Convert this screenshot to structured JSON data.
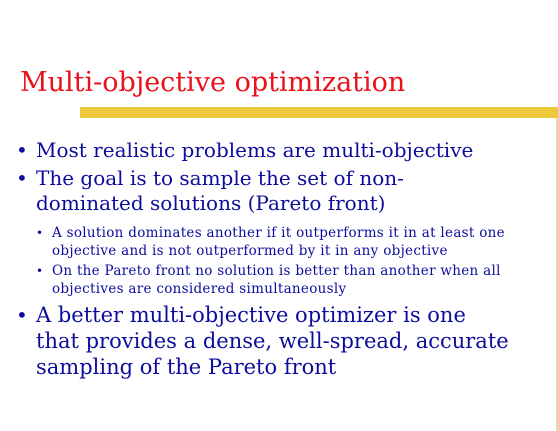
{
  "slide": {
    "title": "Multi-objective optimization",
    "bullet_char": "•",
    "bullets": [
      {
        "level": 1,
        "lines": [
          "Most realistic problems are multi-objective"
        ]
      },
      {
        "level": 1,
        "lines": [
          "The goal is to sample the set of non-",
          "dominated solutions (Pareto front)"
        ]
      },
      {
        "level": 2,
        "lines": [
          "A solution dominates another if it outperforms it in at least one",
          "objective and is not outperformed by it in any objective"
        ]
      },
      {
        "level": 2,
        "lines": [
          "On the Pareto front no solution is better than another when all",
          "objectives are considered simultaneously"
        ]
      },
      {
        "level": 1,
        "lines": [
          "A better multi-objective optimizer is one",
          "that provides a dense, well-spread, accurate",
          "sampling of the Pareto front"
        ]
      }
    ]
  },
  "colors": {
    "title": "#e8121a",
    "body_text": "#0c0c9c",
    "underline_bar": "#ecc93a",
    "background": "#ffffff"
  }
}
